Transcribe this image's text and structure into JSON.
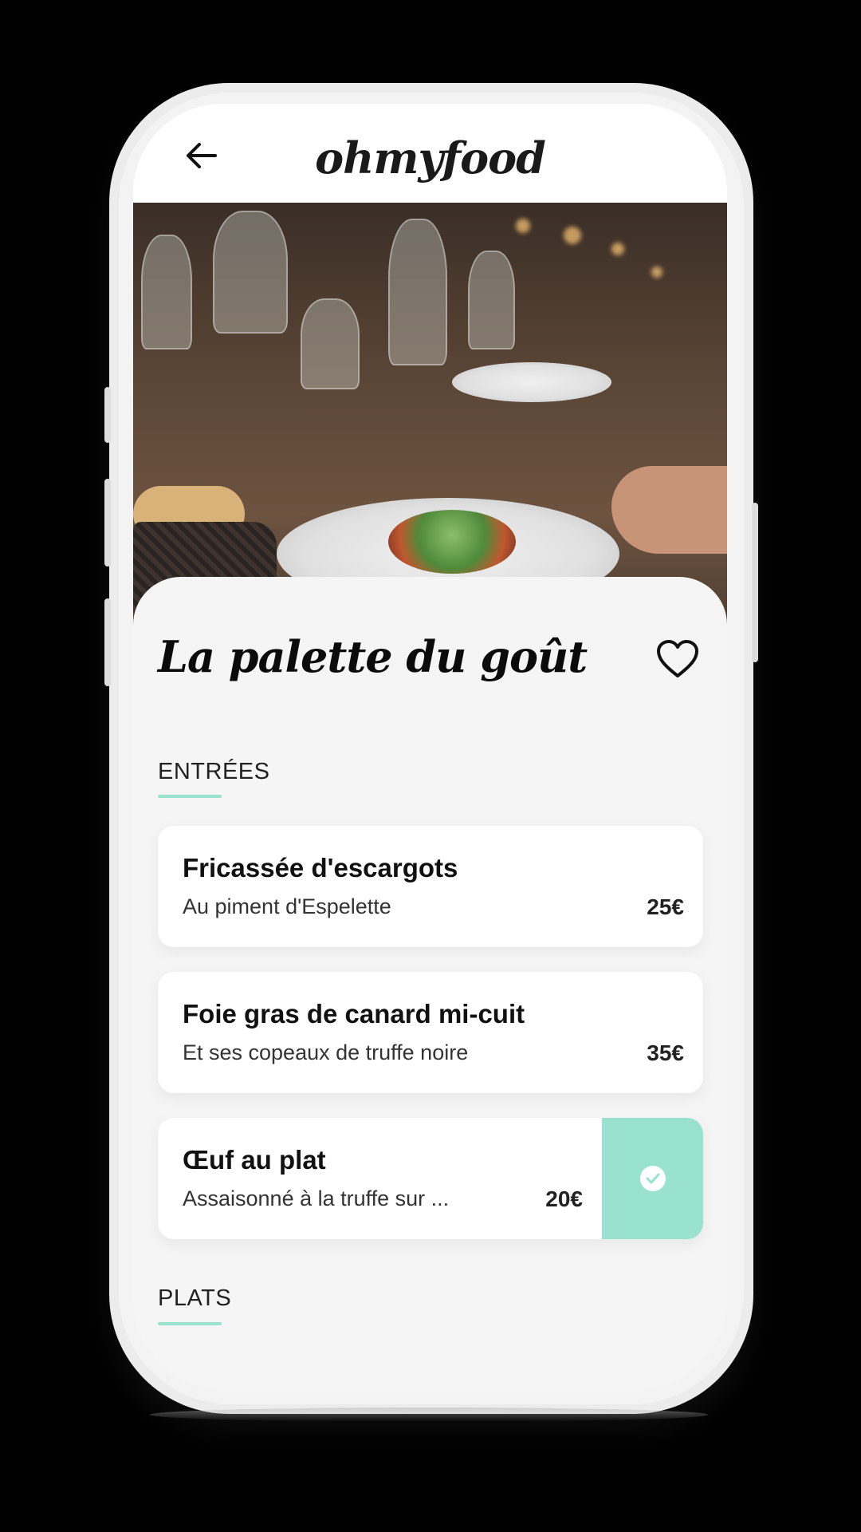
{
  "app": {
    "logo": "ohmyfood"
  },
  "restaurant": {
    "name": "La palette du goût"
  },
  "sections": [
    {
      "title": "ENTRÉES",
      "items": [
        {
          "name": "Fricassée d'escargots",
          "description": "Au piment d'Espelette",
          "price": "25€",
          "selected": false
        },
        {
          "name": "Foie gras de canard mi-cuit",
          "description": "Et ses copeaux de truffe noire",
          "price": "35€",
          "selected": false
        },
        {
          "name": "Œuf au plat",
          "description": "Assaisonné à la truffe sur ...",
          "price": "20€",
          "selected": true
        }
      ]
    },
    {
      "title": "PLATS",
      "items": []
    }
  ],
  "icons": {
    "back": "arrow-left-icon",
    "favorite": "heart-outline-icon",
    "selected": "check-circle-icon"
  },
  "colors": {
    "accent": "#99e2d0",
    "background": "#f5f5f5",
    "card": "#ffffff",
    "text": "#111111"
  }
}
